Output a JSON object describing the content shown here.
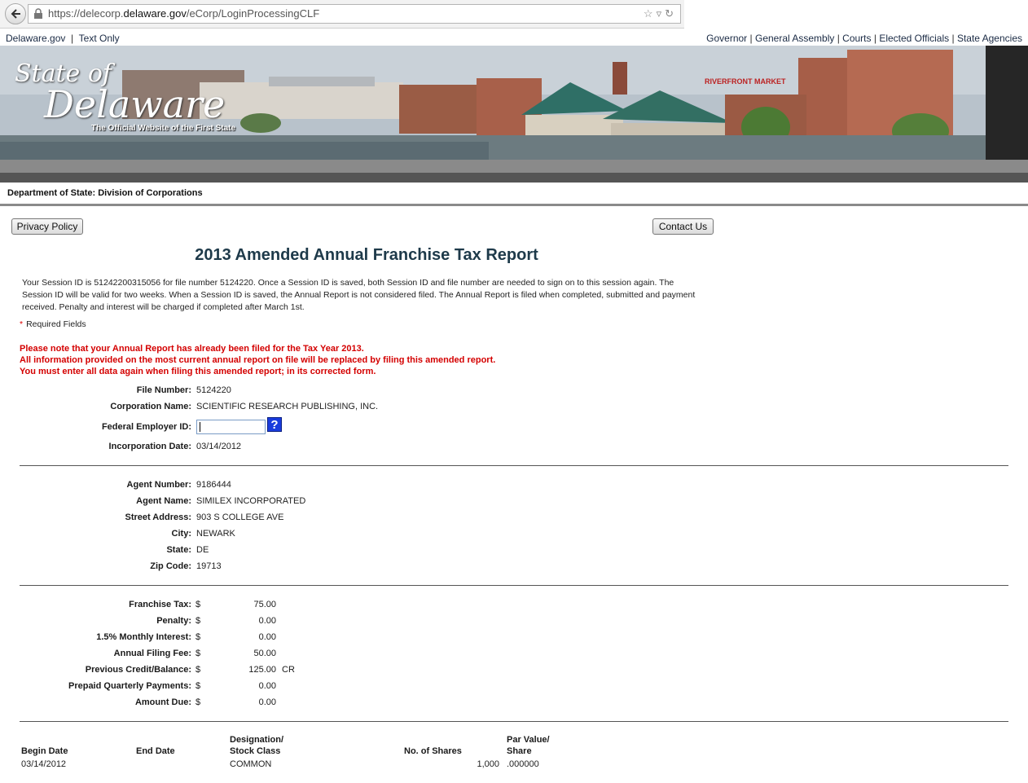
{
  "browser": {
    "url_prefix": "https://delecorp.",
    "url_domain": "delaware.gov",
    "url_path": "/eCorp/LoginProcessingCLF"
  },
  "toplinks": {
    "left": [
      "Delaware.gov",
      "Text Only"
    ],
    "right": [
      "Governor",
      "General Assembly",
      "Courts",
      "Elected Officials",
      "State Agencies"
    ]
  },
  "banner": {
    "logo_line1": "State of",
    "logo_line2": "Delaware",
    "logo_sub": "The Official Website of the First State",
    "sign_text": "RIVERFRONT MARKET"
  },
  "dept_label": "Department of State: Division of Corporations",
  "buttons": {
    "privacy": "Privacy Policy",
    "contact": "Contact Us"
  },
  "title": "2013 Amended Annual Franchise Tax Report",
  "session_paragraph": "Your Session ID is 51242200315056 for file number 5124220. Once a Session ID is saved, both Session ID and file number are needed to sign on to this session again. The Session ID will be valid for two weeks. When a Session ID is saved, the Annual Report is not considered filed. The Annual Report is filed when completed, submitted and payment received. Penalty and interest will be charged if completed after March 1st.",
  "required_star": "*",
  "required_label": "Required Fields",
  "warnings": [
    "Please note that your Annual Report has already been filed for the Tax Year 2013.",
    "All information provided on the most current annual report on file will be replaced by filing this amended report.",
    "You must enter all data again when filing this amended report; in its corrected form."
  ],
  "corp": {
    "file_number_label": "File Number:",
    "file_number": "5124220",
    "corp_name_label": "Corporation Name:",
    "corp_name": "SCIENTIFIC RESEARCH PUBLISHING, INC.",
    "fein_label": "Federal Employer ID:",
    "fein_value": "",
    "help_glyph": "?",
    "inc_date_label": "Incorporation Date:",
    "inc_date": "03/14/2012"
  },
  "agent": {
    "number_label": "Agent Number:",
    "number": "9186444",
    "name_label": "Agent Name:",
    "name": "SIMILEX INCORPORATED",
    "street_label": "Street Address:",
    "street": "903 S COLLEGE AVE",
    "city_label": "City:",
    "city": "NEWARK",
    "state_label": "State:",
    "state": "DE",
    "zip_label": "Zip Code:",
    "zip": "19713"
  },
  "tax": {
    "currency": "$",
    "rows": [
      {
        "label": "Franchise Tax:",
        "amount": "75.00",
        "suffix": ""
      },
      {
        "label": "Penalty:",
        "amount": "0.00",
        "suffix": ""
      },
      {
        "label": "1.5% Monthly Interest:",
        "amount": "0.00",
        "suffix": ""
      },
      {
        "label": "Annual Filing Fee:",
        "amount": "50.00",
        "suffix": ""
      },
      {
        "label": "Previous Credit/Balance:",
        "amount": "125.00",
        "suffix": "CR"
      },
      {
        "label": "Prepaid Quarterly Payments:",
        "amount": "0.00",
        "suffix": ""
      },
      {
        "label": "Amount Due:",
        "amount": "0.00",
        "suffix": ""
      }
    ]
  },
  "stock": {
    "headers": {
      "begin": "Begin Date",
      "end": "End Date",
      "designation1": "Designation/",
      "designation2": "Stock Class",
      "shares": "No. of Shares",
      "par1": "Par Value/",
      "par2": "Share"
    },
    "row": {
      "begin": "03/14/2012",
      "end": "",
      "designation": "COMMON",
      "shares": "1,000",
      "par": ".000000"
    }
  }
}
